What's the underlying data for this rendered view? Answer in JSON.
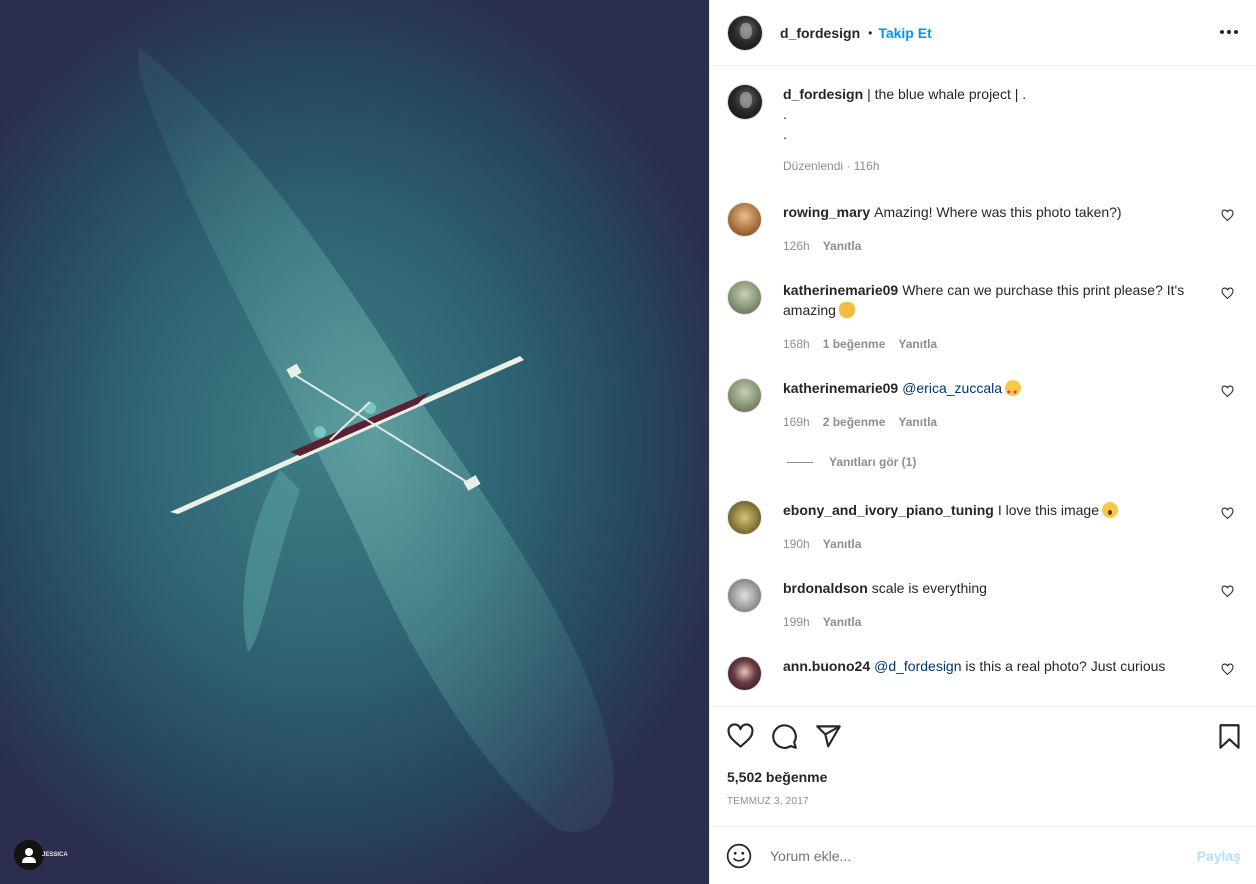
{
  "photo": {
    "watermark": "JESSICA"
  },
  "header": {
    "username": "d_fordesign",
    "separator": "•",
    "follow_label": "Takip Et"
  },
  "caption": {
    "username": "d_fordesign",
    "text": "| the blue whale project | .",
    "line2": ".",
    "line3": ".",
    "edited": "Düzenlendi · 116h"
  },
  "comments": [
    {
      "user": "rowing_mary",
      "text": "Amazing! Where was this photo taken?)",
      "time": "126h",
      "likes": "",
      "reply": "Yanıtla",
      "avatar_color": "#c7955a"
    },
    {
      "user": "katherinemarie09",
      "text": "Where can we purchase this print please? It's amazing",
      "emoji": "ok",
      "time": "168h",
      "likes": "1 beğenme",
      "reply": "Yanıtla",
      "avatar_color": "#8a9a78"
    },
    {
      "user": "katherinemarie09",
      "mention": "@erica_zuccala",
      "text": "",
      "emoji": "star",
      "time": "169h",
      "likes": "2 beğenme",
      "reply": "Yanıtla",
      "avatar_color": "#8a9a78",
      "view_replies": "Yanıtları gör (1)"
    },
    {
      "user": "ebony_and_ivory_piano_tuning",
      "text": "I love this image",
      "emoji": "wow",
      "time": "190h",
      "likes": "",
      "reply": "Yanıtla",
      "avatar_color": "#8b7b3a"
    },
    {
      "user": "brdonaldson",
      "text": "scale is everything",
      "time": "199h",
      "likes": "",
      "reply": "Yanıtla",
      "avatar_color": "#9a9a9a"
    },
    {
      "user": "ann.buono24",
      "mention": "@d_fordesign",
      "text": "is this a real photo? Just curious",
      "time": "",
      "likes": "",
      "reply": "",
      "avatar_color": "#3a2a2e"
    }
  ],
  "actions": {
    "likes": "5,502 beğenme",
    "date": "TEMMUZ 3, 2017"
  },
  "add_comment": {
    "placeholder": "Yorum ekle...",
    "post_label": "Paylaş"
  }
}
